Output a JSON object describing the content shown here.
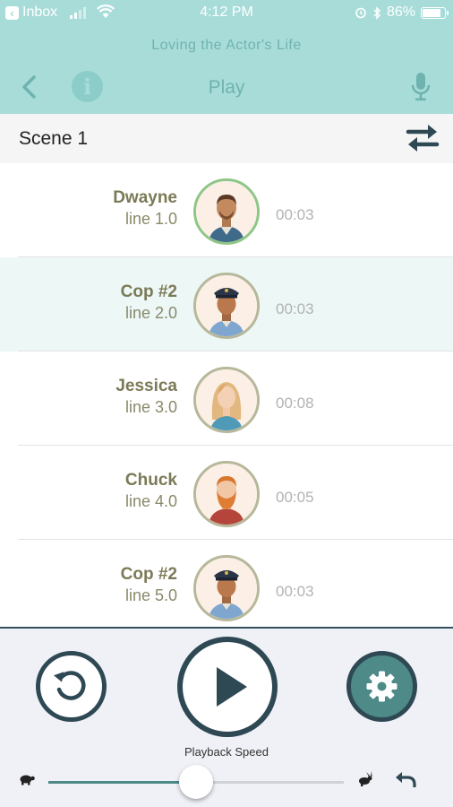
{
  "status": {
    "back_app": "Inbox",
    "time": "4:12 PM",
    "battery": "86%",
    "battery_level": 0.86
  },
  "header": {
    "subtitle": "Loving the Actor's Life",
    "title": "Play",
    "icons": [
      "back-icon",
      "info-icon",
      "microphone-icon"
    ]
  },
  "scene": {
    "title": "Scene 1",
    "swap_icon": "swap-arrows-icon"
  },
  "lines": [
    {
      "name": "Dwayne",
      "line": "line 1.0",
      "duration": "00:03",
      "avatar": "dwayne-avatar"
    },
    {
      "name": "Cop #2",
      "line": "line 2.0",
      "duration": "00:03",
      "avatar": "cop-avatar"
    },
    {
      "name": "Jessica",
      "line": "line 3.0",
      "duration": "00:08",
      "avatar": "jessica-avatar"
    },
    {
      "name": "Chuck",
      "line": "line 4.0",
      "duration": "00:05",
      "avatar": "chuck-avatar"
    },
    {
      "name": "Cop #2",
      "line": "line 5.0",
      "duration": "00:03",
      "avatar": "cop-avatar"
    }
  ],
  "player": {
    "playback_speed_label": "Playback Speed",
    "playback_speed_level": 0.5,
    "icons": [
      "restart-icon",
      "play-icon",
      "gear-icon",
      "turtle-icon",
      "rabbit-icon",
      "undo-icon"
    ]
  },
  "colors": {
    "header_bg": "#a8dcd9",
    "accent": "#2e4954",
    "teal": "#4d8a88",
    "highlight_row": "#ecf7f6"
  }
}
